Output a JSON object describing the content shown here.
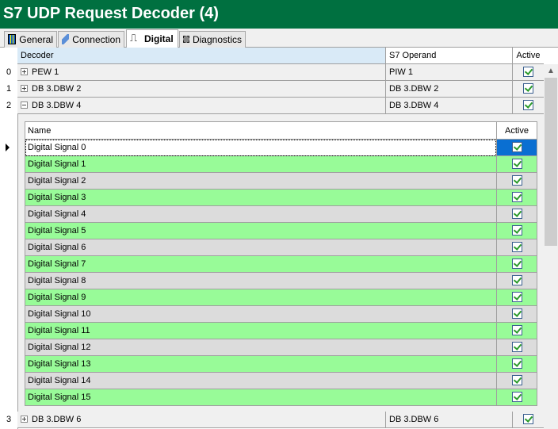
{
  "title": "S7 UDP Request Decoder (4)",
  "tabs": [
    {
      "label": "General",
      "icon": "grid-icon"
    },
    {
      "label": "Connection",
      "icon": "connection-icon"
    },
    {
      "label": "Digital",
      "icon": "digital-signal-icon"
    },
    {
      "label": "Diagnostics",
      "icon": "chip-icon"
    }
  ],
  "grid": {
    "headers": {
      "decoder": "Decoder",
      "operand": "S7 Operand",
      "active": "Active"
    },
    "rows": [
      {
        "index": "0",
        "decoder": "PEW 1",
        "operand": "PIW 1",
        "active": true,
        "expanded": false
      },
      {
        "index": "1",
        "decoder": "DB 3.DBW 2",
        "operand": "DB 3.DBW 2",
        "active": true,
        "expanded": false
      },
      {
        "index": "2",
        "decoder": "DB 3.DBW 4",
        "operand": "DB 3.DBW 4",
        "active": true,
        "expanded": true
      },
      {
        "index": "3",
        "decoder": "DB 3.DBW 6",
        "operand": "DB 3.DBW 6",
        "active": true,
        "expanded": false
      }
    ]
  },
  "detail": {
    "headers": {
      "name": "Name",
      "active": "Active"
    },
    "rows": [
      "Digital Signal 0",
      "Digital Signal 1",
      "Digital Signal 2",
      "Digital Signal 3",
      "Digital Signal 4",
      "Digital Signal 5",
      "Digital Signal 6",
      "Digital Signal 7",
      "Digital Signal 8",
      "Digital Signal 9",
      "Digital Signal 10",
      "Digital Signal 11",
      "Digital Signal 12",
      "Digital Signal 13",
      "Digital Signal 14",
      "Digital Signal 15"
    ]
  },
  "colors": {
    "title_bg": "#007040",
    "odd_row": "#98fb98",
    "even_row": "#dcdcdc",
    "selected": "#0a6fd2"
  }
}
